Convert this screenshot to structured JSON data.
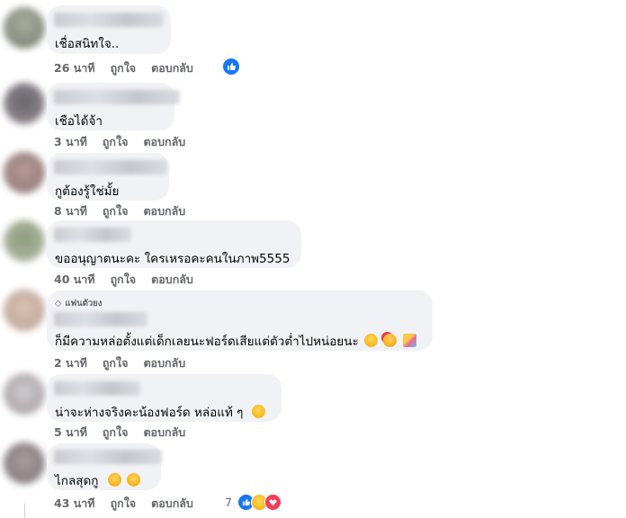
{
  "actions": {
    "like": "ถูกใจ",
    "reply": "ตอบกลับ"
  },
  "colors": {
    "bubble": "#f0f2f5",
    "meta_text": "#65676b",
    "like_blue": "#1877f2"
  },
  "comments": [
    {
      "text": "เชื่อสนิทใจ..",
      "time": "26 นาที",
      "reaction": "like-icon"
    },
    {
      "text": "เชือได้จ้า",
      "time": "3 นาที"
    },
    {
      "text": "กูต้องรู้ใช่มั้ย",
      "time": "8 นาที"
    },
    {
      "text": "ขออนุญาตนะคะ ใครเหรอคะคนในภาพ5555",
      "time": "40 นาที"
    },
    {
      "badge": "แฟนตัวยง",
      "text": "ก็มีความหล่อตั้งแต่เด็กเลยนะฟอร์ดเสียแต่ตัวต่ำไปหน่อยนะ",
      "time": "2 นาที",
      "emojis": [
        "grinning-emoji",
        "smiling-hearts-emoji",
        "party-popper-emoji"
      ]
    },
    {
      "text": "น่าจะห่างจริงคะน้องฟอร์ด หล่อแท้ ๆ",
      "time": "5 นาที",
      "emojis": [
        "smiling-emoji"
      ]
    },
    {
      "text": "ไกลสุดกู",
      "time": "43 นาที",
      "emojis": [
        "flushed-emoji",
        "flushed-emoji"
      ],
      "reaction_count": "7",
      "reactions": [
        "like-icon",
        "haha-icon",
        "love-icon"
      ]
    }
  ]
}
